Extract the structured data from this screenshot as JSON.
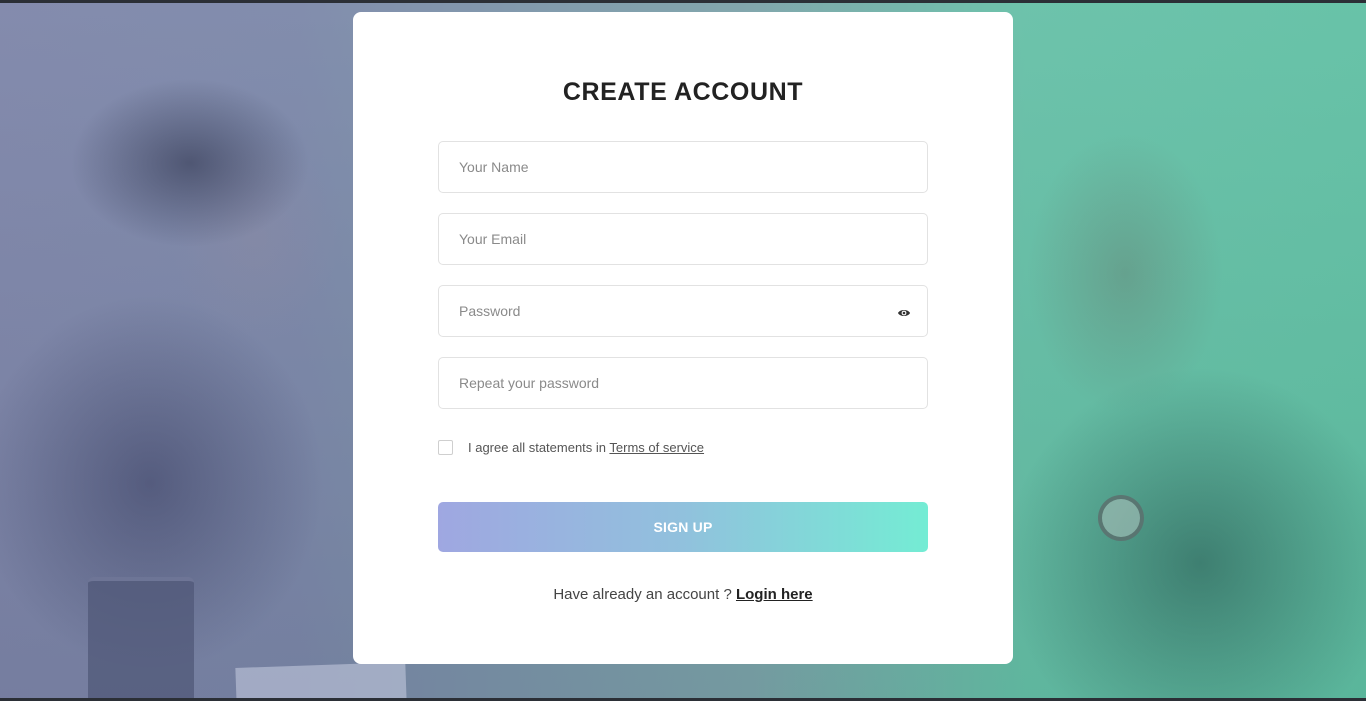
{
  "colors": {
    "card_bg": "#ffffff",
    "button_gradient_start": "#9fa7e1",
    "button_gradient_end": "#74ecd4",
    "bg_overlay_left": "#7c84a8",
    "bg_overlay_right": "#5fbfa3"
  },
  "form": {
    "title": "CREATE ACCOUNT",
    "name_placeholder": "Your Name",
    "email_placeholder": "Your Email",
    "password_placeholder": "Password",
    "password_toggle_icon": "eye-icon",
    "repeat_password_placeholder": "Repeat your password",
    "agree_checked": false,
    "agree_text": "I agree all statements in ",
    "terms_link": "Terms of service",
    "signup_label": "SIGN UP",
    "login_prompt": "Have already an account ? ",
    "login_link": "Login here"
  }
}
